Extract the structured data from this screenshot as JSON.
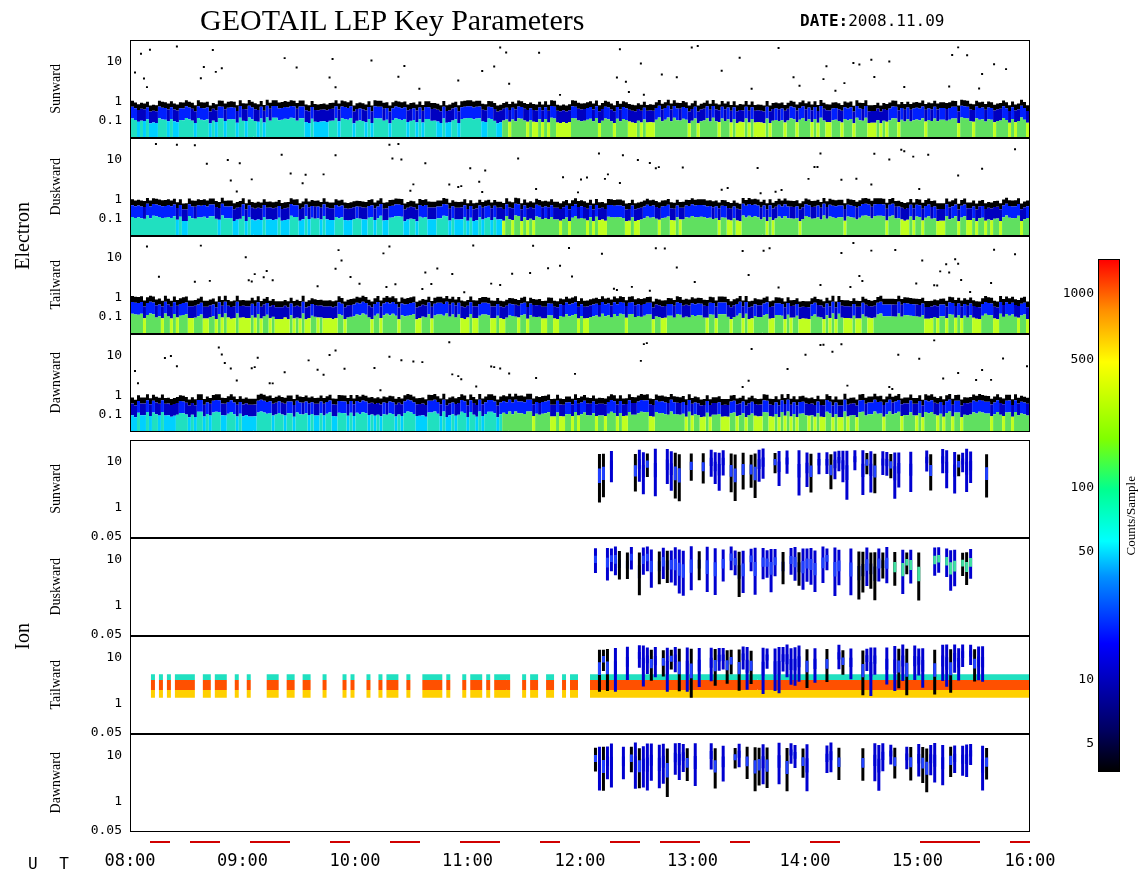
{
  "title": "GEOTAIL LEP Key Parameters",
  "date_label": "DATE:",
  "date": "2008.11.09",
  "groups": [
    {
      "name": "Electron",
      "kind": "electron",
      "panels": [
        {
          "direction": "Sunward",
          "yticks": [
            "10",
            "1",
            "0.1"
          ]
        },
        {
          "direction": "Duskward",
          "yticks": [
            "10",
            "1",
            "0.1"
          ]
        },
        {
          "direction": "Tailward",
          "yticks": [
            "10",
            "1",
            "0.1"
          ]
        },
        {
          "direction": "Dawnward",
          "yticks": [
            "10",
            "1",
            "0.1"
          ]
        }
      ]
    },
    {
      "name": "Ion",
      "kind": "ion",
      "panels": [
        {
          "direction": "Sunward",
          "yticks": [
            "10",
            "1",
            "0.05"
          ]
        },
        {
          "direction": "Duskward",
          "yticks": [
            "10",
            "1",
            "0.05"
          ]
        },
        {
          "direction": "Tailward",
          "yticks": [
            "10",
            "1",
            "0.05"
          ]
        },
        {
          "direction": "Dawnward",
          "yticks": [
            "10",
            "1",
            "0.05"
          ]
        }
      ]
    }
  ],
  "x_axis": {
    "label": "U T",
    "ticks": [
      "08:00",
      "09:00",
      "10:00",
      "11:00",
      "12:00",
      "13:00",
      "14:00",
      "15:00",
      "16:00"
    ]
  },
  "colorbar": {
    "label": "Counts/Sample",
    "ticks": [
      "1000",
      "500",
      "100",
      "50",
      "10",
      "5"
    ]
  }
}
